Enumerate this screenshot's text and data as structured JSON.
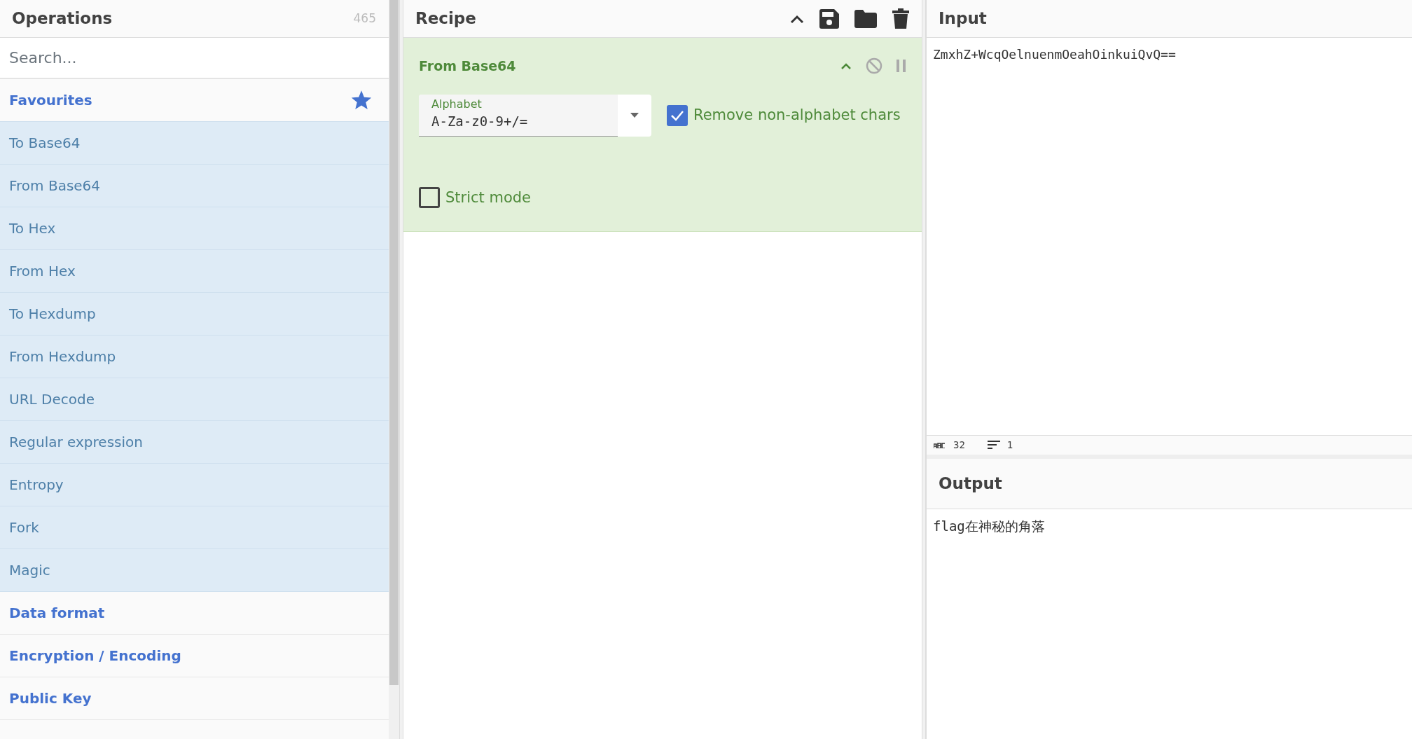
{
  "operations": {
    "title": "Operations",
    "count": "465",
    "search": {
      "placeholder": "Search..."
    },
    "categories": [
      {
        "label": "Favourites",
        "kind": "favourites",
        "expanded": true,
        "items": [
          "To Base64",
          "From Base64",
          "To Hex",
          "From Hex",
          "To Hexdump",
          "From Hexdump",
          "URL Decode",
          "Regular expression",
          "Entropy",
          "Fork",
          "Magic"
        ]
      },
      {
        "label": "Data format",
        "kind": "category",
        "expanded": false
      },
      {
        "label": "Encryption / Encoding",
        "kind": "category",
        "expanded": false
      },
      {
        "label": "Public Key",
        "kind": "category",
        "expanded": false
      }
    ]
  },
  "recipe": {
    "title": "Recipe",
    "steps": [
      {
        "name": "From Base64",
        "args": [
          {
            "kind": "select",
            "label": "Alphabet",
            "value": "A-Za-z0-9+/="
          },
          {
            "kind": "checkbox",
            "label": "Remove non-alphabet chars",
            "checked": true
          },
          {
            "kind": "checkbox",
            "label": "Strict mode",
            "checked": false
          }
        ]
      }
    ]
  },
  "input": {
    "title": "Input",
    "value": "ZmxhZ+WcqOelnuenmOeahOinkuiQvQ==",
    "stats": {
      "length": "32",
      "lines": "1"
    }
  },
  "output": {
    "title": "Output",
    "value": "flag在神秘的角落"
  }
}
